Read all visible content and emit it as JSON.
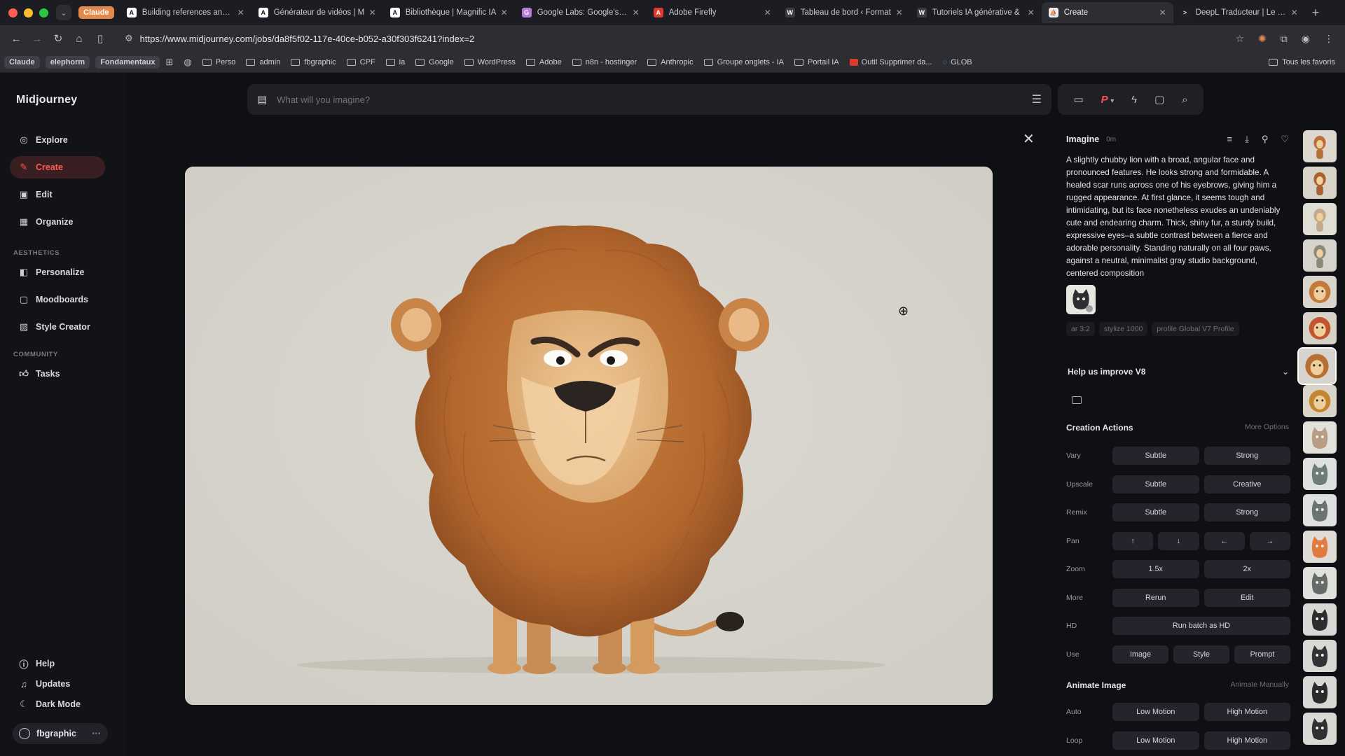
{
  "browser": {
    "claude_label": "Claude",
    "tabs": [
      {
        "title": "Building references and g",
        "fav_bg": "#ffffff",
        "fav_fg": "#111111",
        "fav_char": "A"
      },
      {
        "title": "Générateur de vidéos | M",
        "fav_bg": "#ffffff",
        "fav_fg": "#111111",
        "fav_char": "A"
      },
      {
        "title": "Bibliothèque | Magnific IA",
        "fav_bg": "#ffffff",
        "fav_fg": "#111111",
        "fav_char": "A"
      },
      {
        "title": "Google Labs: Google's hu",
        "fav_bg": "#b77ad8",
        "fav_fg": "#ffffff",
        "fav_char": "G"
      },
      {
        "title": "Adobe Firefly",
        "fav_bg": "#e03a2f",
        "fav_fg": "#ffffff",
        "fav_char": "A"
      },
      {
        "title": "Tableau de bord ‹ Format",
        "fav_bg": "#3a3b40",
        "fav_fg": "#ffffff",
        "fav_char": "W"
      },
      {
        "title": "Tutoriels IA générative &",
        "fav_bg": "#3a3b40",
        "fav_fg": "#ffffff",
        "fav_char": "W"
      },
      {
        "title": "Create",
        "fav_bg": "#eeeeee",
        "fav_fg": "#111111",
        "fav_char": "⛵"
      },
      {
        "title": "DeepL Traducteur | Le me",
        "fav_bg": "#1f2026",
        "fav_fg": "#dddddd",
        "fav_char": ">"
      }
    ],
    "url": "https://www.midjourney.com/jobs/da8f5f02-117e-40ce-b052-a30f303f6241?index=2",
    "bookmarks": {
      "pills": [
        "Claude",
        "elephorm",
        "Fondamentaux"
      ],
      "folders": [
        "Perso",
        "admin",
        "fbgraphic",
        "CPF",
        "ia",
        "Google",
        "WordPress",
        "Adobe",
        "n8n - hostinger",
        "Anthropic",
        "Groupe onglets - IA",
        "Portail IA"
      ],
      "extra": [
        "Outil Supprimer da...",
        "GLOB"
      ],
      "all_label": "Tous les favoris"
    }
  },
  "sidebar": {
    "logo": "Midjourney",
    "items": [
      {
        "label": "Explore",
        "icon": "compass-icon"
      },
      {
        "label": "Create",
        "icon": "brush-icon"
      },
      {
        "label": "Edit",
        "icon": "edit-icon"
      },
      {
        "label": "Organize",
        "icon": "grid-icon"
      }
    ],
    "aesthetics_label": "AESTHETICS",
    "aesthetics_items": [
      {
        "label": "Personalize",
        "icon": "personalize-icon"
      },
      {
        "label": "Moodboards",
        "icon": "moodboard-icon"
      },
      {
        "label": "Style Creator",
        "icon": "style-icon"
      }
    ],
    "community_label": "COMMUNITY",
    "community_items": [
      {
        "label": "Tasks",
        "icon": "thumbs-up-icon"
      }
    ],
    "bottom_items": [
      {
        "label": "Help",
        "icon": "help-icon"
      },
      {
        "label": "Updates",
        "icon": "bell-icon"
      },
      {
        "label": "Dark Mode",
        "icon": "moon-icon"
      }
    ],
    "user": "fbgraphic"
  },
  "search": {
    "placeholder": "What will you imagine?"
  },
  "panel": {
    "title": "Imagine",
    "time_ago": "0m",
    "prompt": "A slightly chubby lion with a broad, angular face and pronounced features. He looks strong and formidable. A healed scar runs across one of his eyebrows, giving him a rugged appearance. At first glance, it seems tough and intimidating, but its face nonetheless exudes an undeniably cute and endearing charm. Thick, shiny fur, a sturdy build, expressive eyes–a subtle contrast between a fierce and adorable personality. Standing naturally on all four paws, against a neutral, minimalist gray studio background, centered composition",
    "tags": [
      "ar 3:2",
      "stylize 1000",
      "profile Global V7 Profile"
    ],
    "help_title": "Help us improve V8",
    "creation_title": "Creation Actions",
    "more_options": "More Options",
    "rows": [
      {
        "label": "Vary",
        "buttons": [
          "Subtle",
          "Strong"
        ]
      },
      {
        "label": "Upscale",
        "buttons": [
          "Subtle",
          "Creative"
        ]
      },
      {
        "label": "Remix",
        "buttons": [
          "Subtle",
          "Strong"
        ]
      },
      {
        "label": "Pan",
        "buttons": [
          "↑",
          "↓",
          "←",
          "→"
        ]
      },
      {
        "label": "Zoom",
        "buttons": [
          "1.5x",
          "2x"
        ]
      },
      {
        "label": "More",
        "buttons": [
          "Rerun",
          "Edit"
        ]
      },
      {
        "label": "HD",
        "buttons": [
          "Run batch as HD"
        ]
      },
      {
        "label": "Use",
        "buttons": [
          "Image",
          "Style",
          "Prompt"
        ]
      }
    ],
    "animate_title": "Animate Image",
    "animate_manually": "Animate Manually",
    "animate_rows": [
      {
        "label": "Auto",
        "buttons": [
          "Low Motion",
          "High Motion"
        ]
      },
      {
        "label": "Loop",
        "buttons": [
          "Low Motion",
          "High Motion"
        ]
      }
    ]
  },
  "thumbnails": [
    {
      "kind": "lion-small",
      "bg": "#dcd8cf",
      "fur": "#b8703b"
    },
    {
      "kind": "lion-small",
      "bg": "#d8d3c9",
      "fur": "#a9622f"
    },
    {
      "kind": "lion-small",
      "bg": "#e0ddd5",
      "fur": "#c4a98d"
    },
    {
      "kind": "lion-small",
      "bg": "#d5d3cc",
      "fur": "#8a8a7a"
    },
    {
      "kind": "lion-head",
      "bg": "#d9d5cc",
      "fur": "#c47a3c"
    },
    {
      "kind": "lion-head",
      "bg": "#d6d2c8",
      "fur": "#c0552e"
    },
    {
      "kind": "lion-head",
      "bg": "#d6d4cc",
      "fur": "#b86f33"
    },
    {
      "kind": "lion-head",
      "bg": "#d8d4ca",
      "fur": "#c4872f"
    },
    {
      "kind": "cat",
      "bg": "#e3e1dc",
      "fur": "#b89c86"
    },
    {
      "kind": "cat",
      "bg": "#dfe1de",
      "fur": "#6e7c78"
    },
    {
      "kind": "cat",
      "bg": "#dfe1de",
      "fur": "#6b7471"
    },
    {
      "kind": "cat",
      "bg": "#dfdcd6",
      "fur": "#e07a3e"
    },
    {
      "kind": "cat",
      "bg": "#e0e1dd",
      "fur": "#646b68"
    },
    {
      "kind": "cat",
      "bg": "#d8d8d4",
      "fur": "#2b2d2f"
    },
    {
      "kind": "cat",
      "bg": "#d8d8d4",
      "fur": "#303234"
    },
    {
      "kind": "cat",
      "bg": "#d8d8d4",
      "fur": "#2a2b2d"
    },
    {
      "kind": "cat",
      "bg": "#d8d8d4",
      "fur": "#2f3032"
    }
  ],
  "selected_thumbnail": 6,
  "colors": {
    "accent": "#ff5a52",
    "accent_bg": "#3a1f22"
  }
}
